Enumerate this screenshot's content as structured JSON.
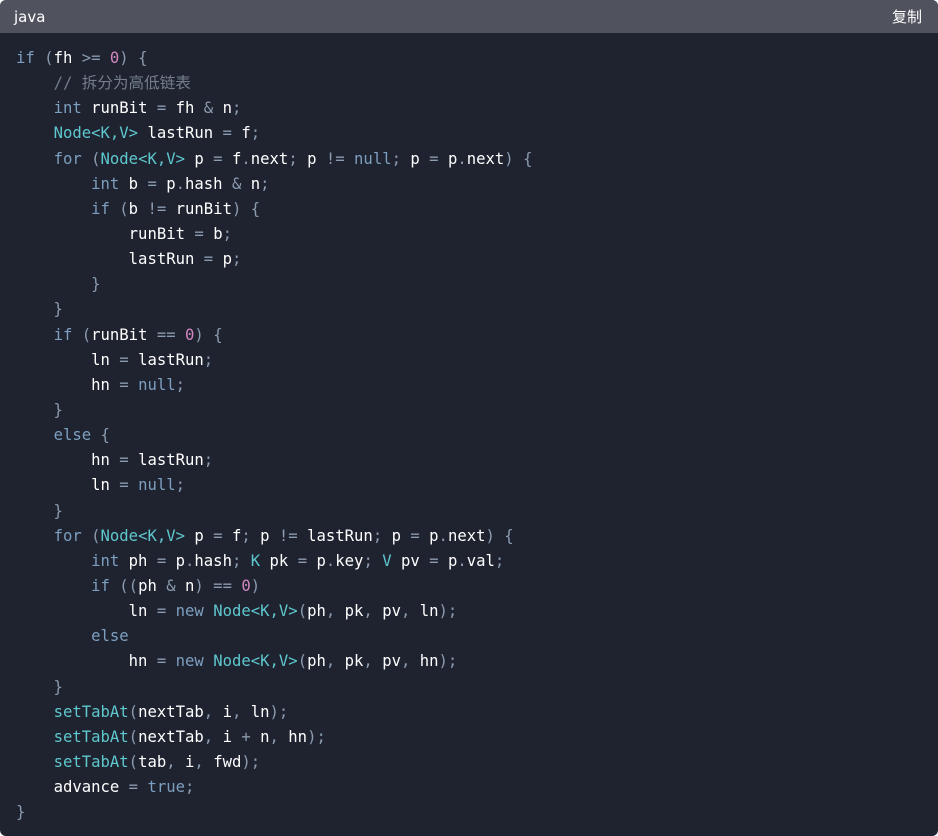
{
  "header": {
    "language": "java",
    "copy_label": "复制"
  },
  "colors": {
    "background": "#1f2330",
    "header": "#50535e",
    "keyword": "#7d9fbf",
    "identifier": "#ffffff",
    "type": "#5ec8ce",
    "number": "#d287c0",
    "comment": "#737d8c",
    "punctuation": "#8b9bb0"
  },
  "code": {
    "lines": [
      [
        [
          "kw",
          "if"
        ],
        [
          "p",
          " ("
        ],
        [
          "id",
          "fh"
        ],
        [
          "p",
          " >= "
        ],
        [
          "num",
          "0"
        ],
        [
          "p",
          ") {"
        ]
      ],
      [
        [
          "p",
          "    "
        ],
        [
          "cm",
          "// 拆分为高低链表"
        ]
      ],
      [
        [
          "p",
          "    "
        ],
        [
          "kw",
          "int"
        ],
        [
          "p",
          " "
        ],
        [
          "id",
          "runBit"
        ],
        [
          "p",
          " = "
        ],
        [
          "id",
          "fh"
        ],
        [
          "p",
          " & "
        ],
        [
          "id",
          "n"
        ],
        [
          "p",
          ";"
        ]
      ],
      [
        [
          "p",
          "    "
        ],
        [
          "type",
          "Node<K,V>"
        ],
        [
          "p",
          " "
        ],
        [
          "id",
          "lastRun"
        ],
        [
          "p",
          " = "
        ],
        [
          "id",
          "f"
        ],
        [
          "p",
          ";"
        ]
      ],
      [
        [
          "p",
          "    "
        ],
        [
          "kw",
          "for"
        ],
        [
          "p",
          " ("
        ],
        [
          "type",
          "Node<K,V>"
        ],
        [
          "p",
          " "
        ],
        [
          "id",
          "p"
        ],
        [
          "p",
          " = "
        ],
        [
          "id",
          "f"
        ],
        [
          "p",
          "."
        ],
        [
          "id",
          "next"
        ],
        [
          "p",
          "; "
        ],
        [
          "id",
          "p"
        ],
        [
          "p",
          " != "
        ],
        [
          "kw",
          "null"
        ],
        [
          "p",
          "; "
        ],
        [
          "id",
          "p"
        ],
        [
          "p",
          " = "
        ],
        [
          "id",
          "p"
        ],
        [
          "p",
          "."
        ],
        [
          "id",
          "next"
        ],
        [
          "p",
          ") {"
        ]
      ],
      [
        [
          "p",
          "        "
        ],
        [
          "kw",
          "int"
        ],
        [
          "p",
          " "
        ],
        [
          "id",
          "b"
        ],
        [
          "p",
          " = "
        ],
        [
          "id",
          "p"
        ],
        [
          "p",
          "."
        ],
        [
          "id",
          "hash"
        ],
        [
          "p",
          " & "
        ],
        [
          "id",
          "n"
        ],
        [
          "p",
          ";"
        ]
      ],
      [
        [
          "p",
          "        "
        ],
        [
          "kw",
          "if"
        ],
        [
          "p",
          " ("
        ],
        [
          "id",
          "b"
        ],
        [
          "p",
          " != "
        ],
        [
          "id",
          "runBit"
        ],
        [
          "p",
          ") {"
        ]
      ],
      [
        [
          "p",
          "            "
        ],
        [
          "id",
          "runBit"
        ],
        [
          "p",
          " = "
        ],
        [
          "id",
          "b"
        ],
        [
          "p",
          ";"
        ]
      ],
      [
        [
          "p",
          "            "
        ],
        [
          "id",
          "lastRun"
        ],
        [
          "p",
          " = "
        ],
        [
          "id",
          "p"
        ],
        [
          "p",
          ";"
        ]
      ],
      [
        [
          "p",
          "        }"
        ]
      ],
      [
        [
          "p",
          "    }"
        ]
      ],
      [
        [
          "p",
          "    "
        ],
        [
          "kw",
          "if"
        ],
        [
          "p",
          " ("
        ],
        [
          "id",
          "runBit"
        ],
        [
          "p",
          " == "
        ],
        [
          "num",
          "0"
        ],
        [
          "p",
          ") {"
        ]
      ],
      [
        [
          "p",
          "        "
        ],
        [
          "id",
          "ln"
        ],
        [
          "p",
          " = "
        ],
        [
          "id",
          "lastRun"
        ],
        [
          "p",
          ";"
        ]
      ],
      [
        [
          "p",
          "        "
        ],
        [
          "id",
          "hn"
        ],
        [
          "p",
          " = "
        ],
        [
          "kw",
          "null"
        ],
        [
          "p",
          ";"
        ]
      ],
      [
        [
          "p",
          "    }"
        ]
      ],
      [
        [
          "p",
          "    "
        ],
        [
          "kw",
          "else"
        ],
        [
          "p",
          " {"
        ]
      ],
      [
        [
          "p",
          "        "
        ],
        [
          "id",
          "hn"
        ],
        [
          "p",
          " = "
        ],
        [
          "id",
          "lastRun"
        ],
        [
          "p",
          ";"
        ]
      ],
      [
        [
          "p",
          "        "
        ],
        [
          "id",
          "ln"
        ],
        [
          "p",
          " = "
        ],
        [
          "kw",
          "null"
        ],
        [
          "p",
          ";"
        ]
      ],
      [
        [
          "p",
          "    }"
        ]
      ],
      [
        [
          "p",
          "    "
        ],
        [
          "kw",
          "for"
        ],
        [
          "p",
          " ("
        ],
        [
          "type",
          "Node<K,V>"
        ],
        [
          "p",
          " "
        ],
        [
          "id",
          "p"
        ],
        [
          "p",
          " = "
        ],
        [
          "id",
          "f"
        ],
        [
          "p",
          "; "
        ],
        [
          "id",
          "p"
        ],
        [
          "p",
          " != "
        ],
        [
          "id",
          "lastRun"
        ],
        [
          "p",
          "; "
        ],
        [
          "id",
          "p"
        ],
        [
          "p",
          " = "
        ],
        [
          "id",
          "p"
        ],
        [
          "p",
          "."
        ],
        [
          "id",
          "next"
        ],
        [
          "p",
          ") {"
        ]
      ],
      [
        [
          "p",
          "        "
        ],
        [
          "kw",
          "int"
        ],
        [
          "p",
          " "
        ],
        [
          "id",
          "ph"
        ],
        [
          "p",
          " = "
        ],
        [
          "id",
          "p"
        ],
        [
          "p",
          "."
        ],
        [
          "id",
          "hash"
        ],
        [
          "p",
          "; "
        ],
        [
          "type",
          "K"
        ],
        [
          "p",
          " "
        ],
        [
          "id",
          "pk"
        ],
        [
          "p",
          " = "
        ],
        [
          "id",
          "p"
        ],
        [
          "p",
          "."
        ],
        [
          "id",
          "key"
        ],
        [
          "p",
          "; "
        ],
        [
          "type",
          "V"
        ],
        [
          "p",
          " "
        ],
        [
          "id",
          "pv"
        ],
        [
          "p",
          " = "
        ],
        [
          "id",
          "p"
        ],
        [
          "p",
          "."
        ],
        [
          "id",
          "val"
        ],
        [
          "p",
          ";"
        ]
      ],
      [
        [
          "p",
          "        "
        ],
        [
          "kw",
          "if"
        ],
        [
          "p",
          " (("
        ],
        [
          "id",
          "ph"
        ],
        [
          "p",
          " & "
        ],
        [
          "id",
          "n"
        ],
        [
          "p",
          ") == "
        ],
        [
          "num",
          "0"
        ],
        [
          "p",
          ")"
        ]
      ],
      [
        [
          "p",
          "            "
        ],
        [
          "id",
          "ln"
        ],
        [
          "p",
          " = "
        ],
        [
          "kw",
          "new"
        ],
        [
          "p",
          " "
        ],
        [
          "type",
          "Node<K,V>"
        ],
        [
          "p",
          "("
        ],
        [
          "id",
          "ph"
        ],
        [
          "p",
          ", "
        ],
        [
          "id",
          "pk"
        ],
        [
          "p",
          ", "
        ],
        [
          "id",
          "pv"
        ],
        [
          "p",
          ", "
        ],
        [
          "id",
          "ln"
        ],
        [
          "p",
          ");"
        ]
      ],
      [
        [
          "p",
          "        "
        ],
        [
          "kw",
          "else"
        ]
      ],
      [
        [
          "p",
          "            "
        ],
        [
          "id",
          "hn"
        ],
        [
          "p",
          " = "
        ],
        [
          "kw",
          "new"
        ],
        [
          "p",
          " "
        ],
        [
          "type",
          "Node<K,V>"
        ],
        [
          "p",
          "("
        ],
        [
          "id",
          "ph"
        ],
        [
          "p",
          ", "
        ],
        [
          "id",
          "pk"
        ],
        [
          "p",
          ", "
        ],
        [
          "id",
          "pv"
        ],
        [
          "p",
          ", "
        ],
        [
          "id",
          "hn"
        ],
        [
          "p",
          ");"
        ]
      ],
      [
        [
          "p",
          "    }"
        ]
      ],
      [
        [
          "p",
          "    "
        ],
        [
          "type",
          "setTabAt"
        ],
        [
          "p",
          "("
        ],
        [
          "id",
          "nextTab"
        ],
        [
          "p",
          ", "
        ],
        [
          "id",
          "i"
        ],
        [
          "p",
          ", "
        ],
        [
          "id",
          "ln"
        ],
        [
          "p",
          ");"
        ]
      ],
      [
        [
          "p",
          "    "
        ],
        [
          "type",
          "setTabAt"
        ],
        [
          "p",
          "("
        ],
        [
          "id",
          "nextTab"
        ],
        [
          "p",
          ", "
        ],
        [
          "id",
          "i"
        ],
        [
          "p",
          " + "
        ],
        [
          "id",
          "n"
        ],
        [
          "p",
          ", "
        ],
        [
          "id",
          "hn"
        ],
        [
          "p",
          ");"
        ]
      ],
      [
        [
          "p",
          "    "
        ],
        [
          "type",
          "setTabAt"
        ],
        [
          "p",
          "("
        ],
        [
          "id",
          "tab"
        ],
        [
          "p",
          ", "
        ],
        [
          "id",
          "i"
        ],
        [
          "p",
          ", "
        ],
        [
          "id",
          "fwd"
        ],
        [
          "p",
          ");"
        ]
      ],
      [
        [
          "p",
          "    "
        ],
        [
          "id",
          "advance"
        ],
        [
          "p",
          " = "
        ],
        [
          "kw",
          "true"
        ],
        [
          "p",
          ";"
        ]
      ],
      [
        [
          "p",
          "}"
        ]
      ]
    ]
  }
}
